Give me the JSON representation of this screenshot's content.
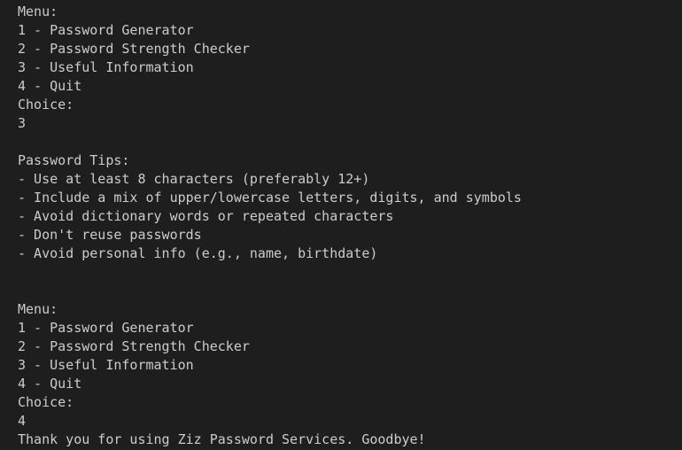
{
  "console": {
    "lines": [
      "Menu:",
      "1 - Password Generator",
      "2 - Password Strength Checker",
      "3 - Useful Information",
      "4 - Quit",
      "Choice:",
      "3",
      "",
      "Password Tips:",
      "- Use at least 8 characters (preferably 12+)",
      "- Include a mix of upper/lowercase letters, digits, and symbols",
      "- Avoid dictionary words or repeated characters",
      "- Don't reuse passwords",
      "- Avoid personal info (e.g., name, birthdate)",
      "",
      "",
      "Menu:",
      "1 - Password Generator",
      "2 - Password Strength Checker",
      "3 - Useful Information",
      "4 - Quit",
      "Choice:",
      "4",
      "Thank you for using Ziz Password Services. Goodbye!"
    ],
    "background_color": "#1e1e1e",
    "text_color": "#cccccc"
  }
}
